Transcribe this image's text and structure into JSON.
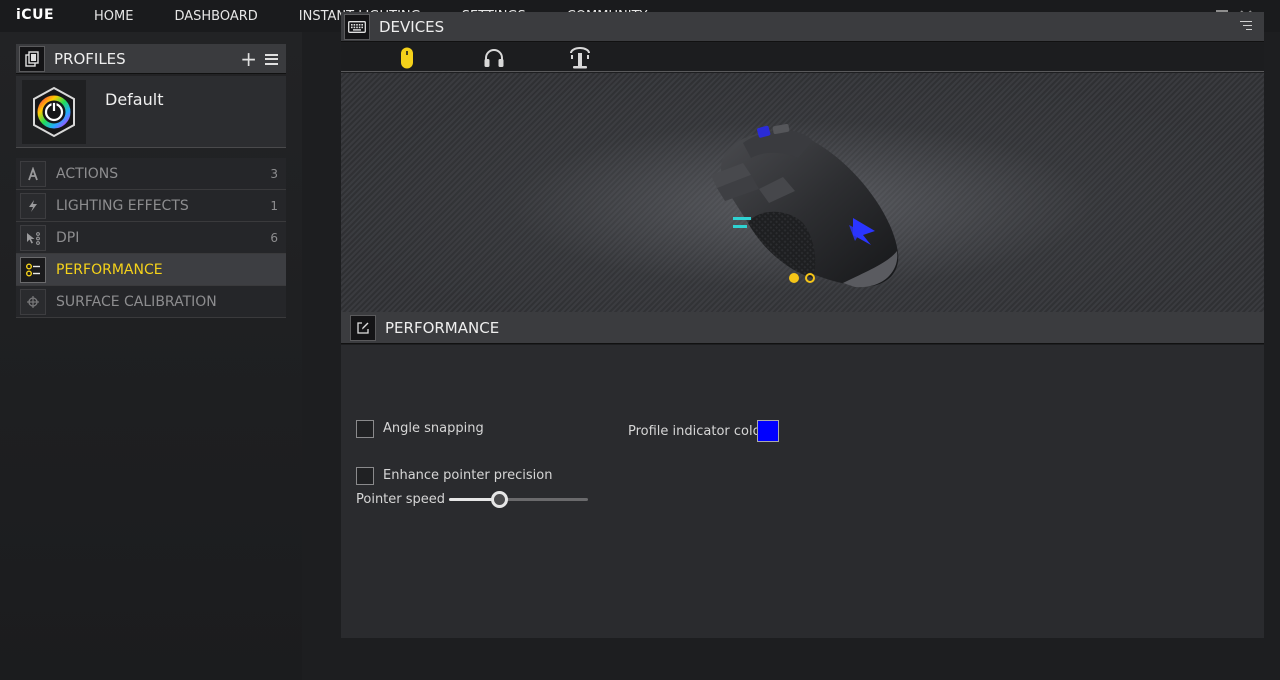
{
  "app": {
    "logo": "iCUE",
    "nav": [
      "HOME",
      "DASHBOARD",
      "INSTANT LIGHTING",
      "SETTINGS",
      "COMMUNITY"
    ]
  },
  "profiles": {
    "title": "PROFILES",
    "add_label": "+",
    "current": {
      "name": "Default"
    },
    "menu": [
      {
        "label": "ACTIONS",
        "count": "3",
        "icon": "actions-icon",
        "active": false
      },
      {
        "label": "LIGHTING EFFECTS",
        "count": "1",
        "icon": "lightning-icon",
        "active": false
      },
      {
        "label": "DPI",
        "count": "6",
        "icon": "dpi-icon",
        "active": false
      },
      {
        "label": "PERFORMANCE",
        "count": "",
        "icon": "performance-icon",
        "active": true
      },
      {
        "label": "SURFACE CALIBRATION",
        "count": "",
        "icon": "crosshair-icon",
        "active": false
      }
    ]
  },
  "devices": {
    "title": "DEVICES",
    "tabs": [
      {
        "icon": "mouse-icon",
        "active": true
      },
      {
        "icon": "headset-icon",
        "active": false
      },
      {
        "icon": "headset-stand-icon",
        "active": false
      }
    ],
    "pager": {
      "count": 2,
      "active_index": 0
    }
  },
  "performance": {
    "title": "PERFORMANCE",
    "angle_snapping": {
      "label": "Angle snapping",
      "checked": false
    },
    "enhance_precision": {
      "label": "Enhance pointer precision",
      "checked": false
    },
    "pointer_speed": {
      "label": "Pointer speed",
      "value_fraction": 0.36
    },
    "profile_indicator": {
      "label": "Profile indicator color",
      "color": "#0000ff"
    }
  },
  "colors": {
    "accent": "#f5c518",
    "active_menu_text": "#f5d21a"
  }
}
